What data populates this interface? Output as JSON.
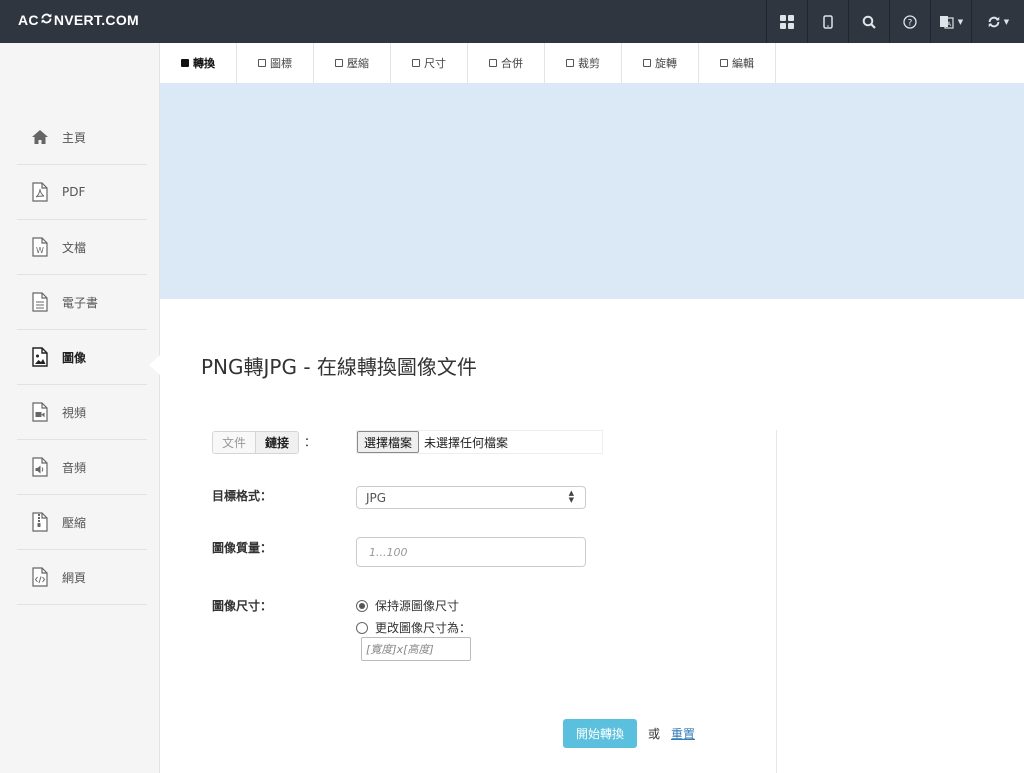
{
  "header": {
    "logo_left": "AC",
    "logo_right": "NVERT.COM",
    "icons": [
      "grid-icon",
      "tablet-icon",
      "search-icon",
      "help-icon",
      "language-icon",
      "refresh-icon"
    ]
  },
  "tabs": [
    {
      "label": "轉換",
      "active": true
    },
    {
      "label": "圖標",
      "active": false
    },
    {
      "label": "壓縮",
      "active": false
    },
    {
      "label": "尺寸",
      "active": false
    },
    {
      "label": "合併",
      "active": false
    },
    {
      "label": "裁剪",
      "active": false
    },
    {
      "label": "旋轉",
      "active": false
    },
    {
      "label": "編輯",
      "active": false
    }
  ],
  "sidebar": {
    "items": [
      {
        "label": "主頁",
        "icon": "home-icon"
      },
      {
        "label": "PDF",
        "icon": "pdf-icon"
      },
      {
        "label": "文檔",
        "icon": "word-document-icon"
      },
      {
        "label": "電子書",
        "icon": "ebook-icon"
      },
      {
        "label": "圖像",
        "icon": "image-icon",
        "active": true
      },
      {
        "label": "視頻",
        "icon": "video-icon"
      },
      {
        "label": "音頻",
        "icon": "audio-icon"
      },
      {
        "label": "壓縮",
        "icon": "archive-icon"
      },
      {
        "label": "網頁",
        "icon": "webpage-icon"
      }
    ]
  },
  "main": {
    "title": "PNG轉JPG - 在線轉換圖像文件",
    "source_tab_file": "文件",
    "source_tab_link": "鏈接",
    "source_colon": "：",
    "file_button": "選擇檔案",
    "file_none": "未選擇任何檔案",
    "format_label": "目標格式：",
    "format_value": "JPG",
    "quality_label": "圖像質量：",
    "quality_placeholder": "1...100",
    "size_label": "圖像尺寸：",
    "size_option_keep": "保持源圖像尺寸",
    "size_option_change": "更改圖像尺寸為：",
    "size_placeholder": "[寬度]x[高度]",
    "submit": "開始轉換",
    "or": "或",
    "reset": "重置"
  },
  "colors": {
    "topbar": "#2f3640",
    "banner": "#dbe9f6",
    "submit": "#5bc0de",
    "link": "#337ab7"
  }
}
